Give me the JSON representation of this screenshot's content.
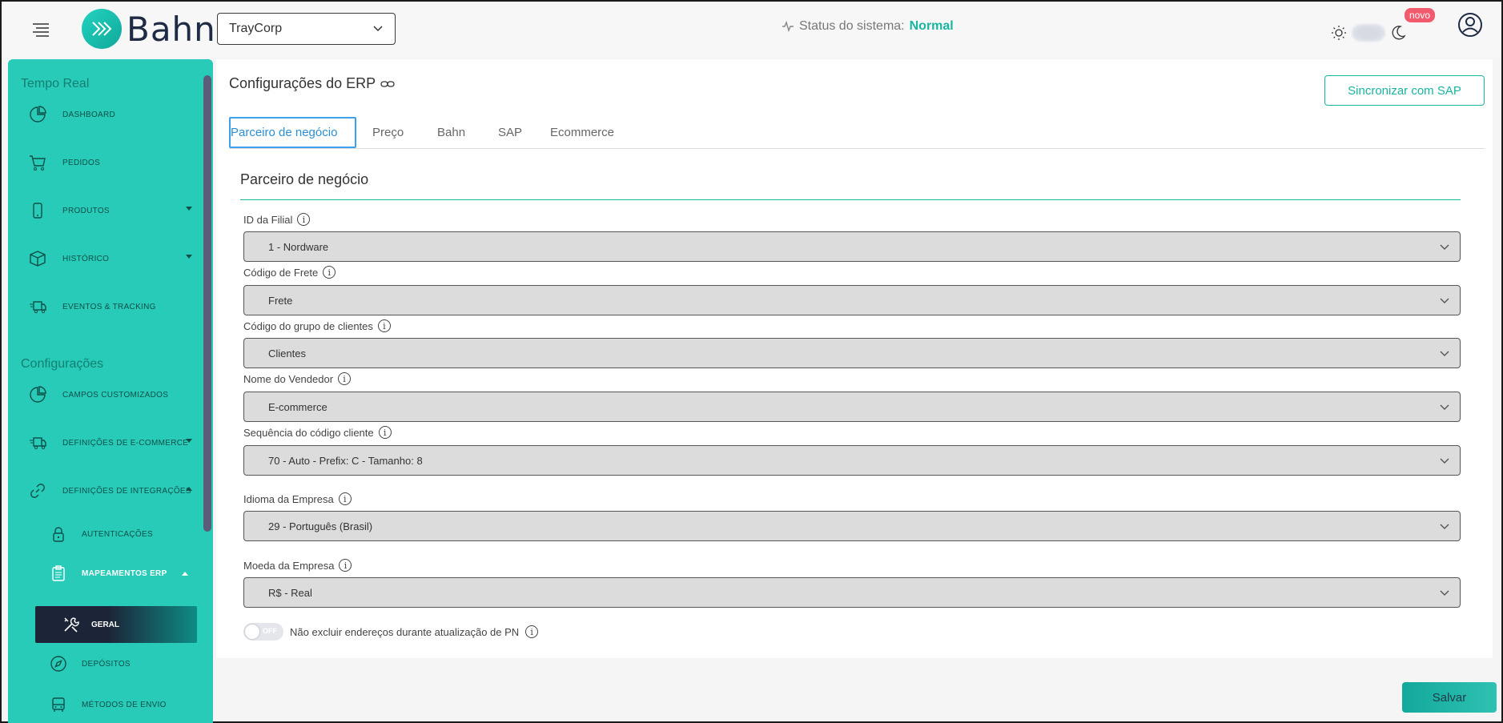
{
  "header": {
    "logo_text": "Bahn",
    "company_select": "TrayCorp",
    "status_label": "Status do sistema:",
    "status_value": "Normal",
    "novo_badge": "novo"
  },
  "sidebar": {
    "section1": "Tempo Real",
    "section2": "Configurações",
    "items": [
      {
        "label": "DASHBOARD",
        "icon": "pie-chart-icon"
      },
      {
        "label": "PEDIDOS",
        "icon": "cart-icon"
      },
      {
        "label": "PRODUTOS",
        "icon": "mobile-icon"
      },
      {
        "label": "HISTÓRICO",
        "icon": "box-icon"
      },
      {
        "label": "EVENTOS & TRACKING",
        "icon": "truck-icon"
      },
      {
        "label": "CAMPOS CUSTOMIZADOS",
        "icon": "pie-chart-icon"
      },
      {
        "label": "DEFINIÇÕES DE E-COMMERCE",
        "icon": "truck-icon"
      },
      {
        "label": "DEFINIÇÕES DE INTEGRAÇÕES",
        "icon": "link-icon"
      }
    ],
    "sub_items": [
      {
        "label": "AUTENTICAÇÕES",
        "icon": "lock-icon"
      },
      {
        "label": "MAPEAMENTOS ERP",
        "icon": "clipboard-icon"
      },
      {
        "label": "GERAL",
        "icon": "tools-icon"
      },
      {
        "label": "DEPÓSITOS",
        "icon": "compass-icon"
      },
      {
        "label": "MÉTODOS DE ENVIO",
        "icon": "bus-icon"
      }
    ]
  },
  "main": {
    "title": "Configurações do ERP",
    "sync_button": "Sincronizar com SAP",
    "tabs": [
      "Parceiro de negócio",
      "Preço",
      "Bahn",
      "SAP",
      "Ecommerce"
    ],
    "section_title": "Parceiro de negócio",
    "fields": [
      {
        "label": "ID da Filial",
        "value": "1 - Nordware"
      },
      {
        "label": "Código de Frete",
        "value": "Frete"
      },
      {
        "label": "Código do grupo de clientes",
        "value": "Clientes"
      },
      {
        "label": "Nome do Vendedor",
        "value": "E-commerce"
      },
      {
        "label": "Sequência do código cliente",
        "value": "70 - Auto - Prefix: C - Tamanho: 8"
      },
      {
        "label": "Idioma da Empresa",
        "value": "29 - Português (Brasil)"
      },
      {
        "label": "Moeda da Empresa",
        "value": "R$ - Real"
      }
    ],
    "switch_state": "OFF",
    "switch_label": "Não excluir endereços durante atualização de PN"
  },
  "save_button": "Salvar",
  "colors": {
    "accent": "#27cbb8",
    "accent_dark": "#18b5a1",
    "active_nav": "#1c2438",
    "tab_active": "#3da0e8",
    "badge": "#f25b6d"
  }
}
